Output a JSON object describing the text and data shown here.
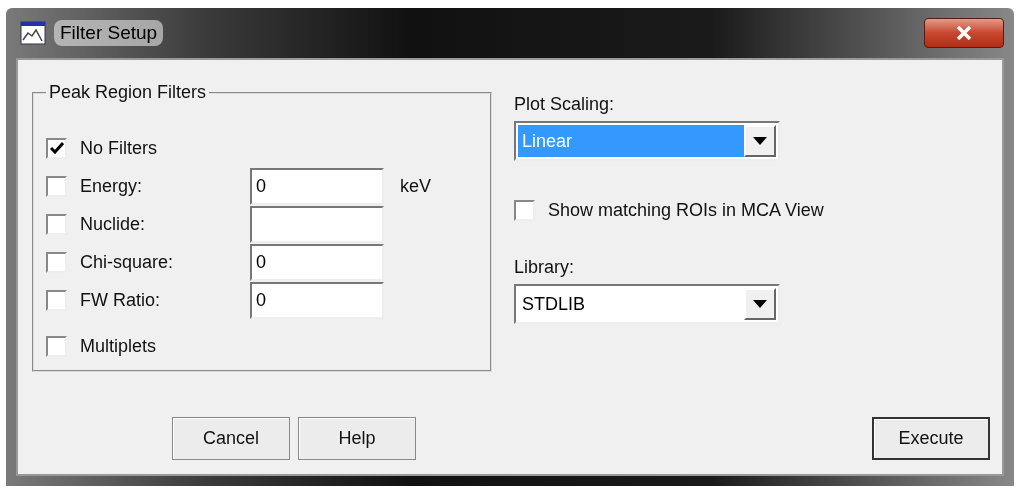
{
  "window": {
    "title": "Filter Setup"
  },
  "peak_region_filters": {
    "title": "Peak Region Filters",
    "items": [
      {
        "kind": "checkbox",
        "label": "No Filters",
        "checked": true
      },
      {
        "kind": "field",
        "label": "Energy:",
        "checked": false,
        "value": "0",
        "unit": "keV"
      },
      {
        "kind": "field",
        "label": "Nuclide:",
        "checked": false
      },
      {
        "kind": "field",
        "label": "Chi-square:",
        "checked": false,
        "value": "0"
      },
      {
        "kind": "field",
        "label": "FW Ratio:",
        "checked": false,
        "value": "0"
      },
      {
        "kind": "checkbox",
        "label": "Multiplets",
        "checked": false
      }
    ]
  },
  "plot_scaling": {
    "label": "Plot Scaling:",
    "value": "Linear",
    "highlighted": true
  },
  "show_matching_rois": {
    "label": "Show matching ROIs in MCA View",
    "checked": false
  },
  "library": {
    "label": "Library:",
    "value": "STDLIB",
    "highlighted": false
  },
  "buttons": [
    {
      "label": "Cancel",
      "default": false
    },
    {
      "label": "Help",
      "default": false
    },
    {
      "label": "Execute",
      "default": true
    }
  ]
}
